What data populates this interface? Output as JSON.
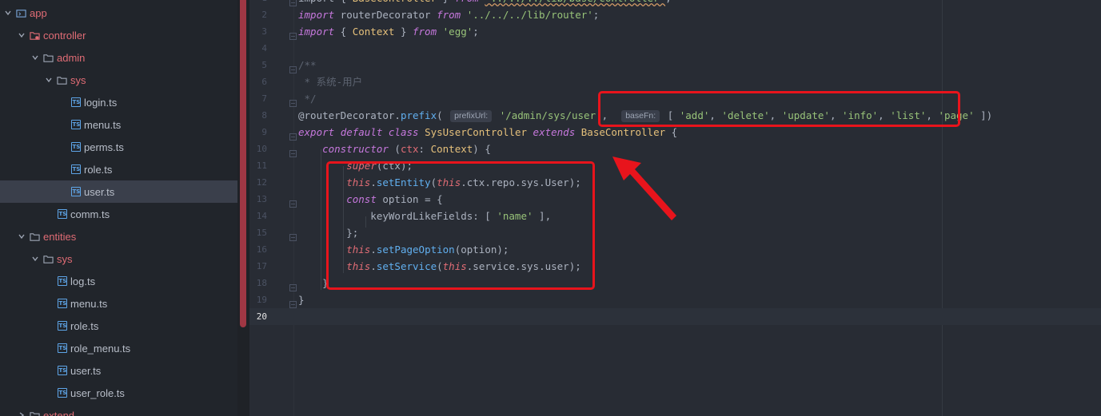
{
  "sidebar": {
    "tree": [
      {
        "label": "app",
        "type": "folder",
        "depth": 0,
        "open": true,
        "icon": "app-folder-icon"
      },
      {
        "label": "controller",
        "type": "folder",
        "depth": 1,
        "open": true,
        "icon": "controller-folder-icon"
      },
      {
        "label": "admin",
        "type": "folder",
        "depth": 2,
        "open": true,
        "icon": "folder-icon"
      },
      {
        "label": "sys",
        "type": "folder",
        "depth": 3,
        "open": true,
        "icon": "folder-icon"
      },
      {
        "label": "login.ts",
        "type": "file",
        "depth": 4,
        "icon": "typescript-file-icon"
      },
      {
        "label": "menu.ts",
        "type": "file",
        "depth": 4,
        "icon": "typescript-file-icon"
      },
      {
        "label": "perms.ts",
        "type": "file",
        "depth": 4,
        "icon": "typescript-file-icon"
      },
      {
        "label": "role.ts",
        "type": "file",
        "depth": 4,
        "icon": "typescript-file-icon"
      },
      {
        "label": "user.ts",
        "type": "file",
        "depth": 4,
        "icon": "typescript-file-icon",
        "selected": true
      },
      {
        "label": "comm.ts",
        "type": "file",
        "depth": 3,
        "icon": "typescript-file-icon"
      },
      {
        "label": "entities",
        "type": "folder",
        "depth": 1,
        "open": true,
        "icon": "folder-icon"
      },
      {
        "label": "sys",
        "type": "folder",
        "depth": 2,
        "open": true,
        "icon": "folder-icon"
      },
      {
        "label": "log.ts",
        "type": "file",
        "depth": 3,
        "icon": "typescript-file-icon"
      },
      {
        "label": "menu.ts",
        "type": "file",
        "depth": 3,
        "icon": "typescript-file-icon"
      },
      {
        "label": "role.ts",
        "type": "file",
        "depth": 3,
        "icon": "typescript-file-icon"
      },
      {
        "label": "role_menu.ts",
        "type": "file",
        "depth": 3,
        "icon": "typescript-file-icon"
      },
      {
        "label": "user.ts",
        "type": "file",
        "depth": 3,
        "icon": "typescript-file-icon"
      },
      {
        "label": "user_role.ts",
        "type": "file",
        "depth": 3,
        "icon": "typescript-file-icon"
      },
      {
        "label": "extend",
        "type": "folder",
        "depth": 1,
        "open": false,
        "icon": "folder-icon"
      }
    ]
  },
  "editor": {
    "active_line": 20,
    "lines": [
      {
        "n": "1",
        "tokens": [
          [
            "pun",
            "import { "
          ],
          [
            "cls",
            "BaseController"
          ],
          [
            "pun",
            " } "
          ],
          [
            "kw",
            "from"
          ],
          [
            "pun",
            " "
          ],
          [
            "str",
            "'../../../lib/base/controller'"
          ],
          [
            "pun",
            ";"
          ]
        ]
      },
      {
        "n": "2",
        "tokens": [
          [
            "kw",
            "import"
          ],
          [
            "pun",
            " routerDecorator "
          ],
          [
            "kw",
            "from"
          ],
          [
            "pun",
            " "
          ],
          [
            "str",
            "'../../../lib/router'"
          ],
          [
            "pun",
            ";"
          ]
        ]
      },
      {
        "n": "3",
        "tokens": [
          [
            "kw",
            "import"
          ],
          [
            "pun",
            " { "
          ],
          [
            "cls",
            "Context"
          ],
          [
            "pun",
            " } "
          ],
          [
            "kw",
            "from"
          ],
          [
            "pun",
            " "
          ],
          [
            "str",
            "'egg'"
          ],
          [
            "pun",
            ";"
          ]
        ]
      },
      {
        "n": "4",
        "tokens": []
      },
      {
        "n": "5",
        "tokens": [
          [
            "com",
            "/**"
          ]
        ]
      },
      {
        "n": "6",
        "tokens": [
          [
            "com",
            " * 系统-用户"
          ]
        ]
      },
      {
        "n": "7",
        "tokens": [
          [
            "com",
            " */"
          ]
        ]
      },
      {
        "n": "8",
        "tokens": [
          [
            "pun",
            "@routerDecorator."
          ],
          [
            "fn",
            "prefix"
          ],
          [
            "pun",
            "( "
          ],
          [
            "hint",
            "prefixUrl:"
          ],
          [
            "pun",
            " "
          ],
          [
            "str",
            "'/admin/sys/user'"
          ],
          [
            "pun",
            ",  "
          ],
          [
            "hint",
            "baseFn:"
          ],
          [
            "pun",
            " [ "
          ],
          [
            "str",
            "'add'"
          ],
          [
            "pun",
            ", "
          ],
          [
            "str",
            "'delete'"
          ],
          [
            "pun",
            ", "
          ],
          [
            "str",
            "'update'"
          ],
          [
            "pun",
            ", "
          ],
          [
            "str",
            "'info'"
          ],
          [
            "pun",
            ", "
          ],
          [
            "str",
            "'list'"
          ],
          [
            "pun",
            ", "
          ],
          [
            "str",
            "'page'"
          ],
          [
            "pun",
            " ])"
          ]
        ]
      },
      {
        "n": "9",
        "tokens": [
          [
            "kw",
            "export"
          ],
          [
            "pun",
            " "
          ],
          [
            "kw",
            "default"
          ],
          [
            "pun",
            " "
          ],
          [
            "kw",
            "class"
          ],
          [
            "pun",
            " "
          ],
          [
            "cls",
            "SysUserController"
          ],
          [
            "pun",
            " "
          ],
          [
            "kw",
            "extends"
          ],
          [
            "pun",
            " "
          ],
          [
            "cls",
            "BaseController"
          ],
          [
            "pun",
            " {"
          ]
        ]
      },
      {
        "n": "10",
        "tokens": [
          [
            "pun",
            "    "
          ],
          [
            "kw",
            "constructor"
          ],
          [
            "pun",
            " ("
          ],
          [
            "param",
            "ctx"
          ],
          [
            "pun",
            ": "
          ],
          [
            "cls",
            "Context"
          ],
          [
            "pun",
            ") {"
          ]
        ]
      },
      {
        "n": "11",
        "tokens": [
          [
            "pun",
            "        "
          ],
          [
            "this",
            "super"
          ],
          [
            "pun",
            "(ctx);"
          ]
        ]
      },
      {
        "n": "12",
        "tokens": [
          [
            "pun",
            "        "
          ],
          [
            "this",
            "this"
          ],
          [
            "pun",
            "."
          ],
          [
            "fn",
            "setEntity"
          ],
          [
            "pun",
            "("
          ],
          [
            "this",
            "this"
          ],
          [
            "pun",
            ".ctx.repo.sys.User);"
          ]
        ]
      },
      {
        "n": "13",
        "tokens": [
          [
            "pun",
            "        "
          ],
          [
            "kw",
            "const"
          ],
          [
            "pun",
            " option = {"
          ]
        ]
      },
      {
        "n": "14",
        "tokens": [
          [
            "pun",
            "            keyWordLikeFields: [ "
          ],
          [
            "str",
            "'name'"
          ],
          [
            "pun",
            " ],"
          ]
        ]
      },
      {
        "n": "15",
        "tokens": [
          [
            "pun",
            "        };"
          ]
        ]
      },
      {
        "n": "16",
        "tokens": [
          [
            "pun",
            "        "
          ],
          [
            "this",
            "this"
          ],
          [
            "pun",
            "."
          ],
          [
            "fn",
            "setPageOption"
          ],
          [
            "pun",
            "(option);"
          ]
        ]
      },
      {
        "n": "17",
        "tokens": [
          [
            "pun",
            "        "
          ],
          [
            "this",
            "this"
          ],
          [
            "pun",
            "."
          ],
          [
            "fn",
            "setService"
          ],
          [
            "pun",
            "("
          ],
          [
            "this",
            "this"
          ],
          [
            "pun",
            ".service.sys.user);"
          ]
        ]
      },
      {
        "n": "18",
        "tokens": [
          [
            "pun",
            "    }"
          ]
        ]
      },
      {
        "n": "19",
        "tokens": [
          [
            "pun",
            "}"
          ]
        ]
      },
      {
        "n": "20",
        "tokens": []
      }
    ]
  },
  "colors": {
    "annotation": "#e8141c",
    "sidebar_bg": "#21252b",
    "editor_bg": "#282c34",
    "folder_label": "#e06c75",
    "scrollbar_thumb": "#a03744"
  }
}
